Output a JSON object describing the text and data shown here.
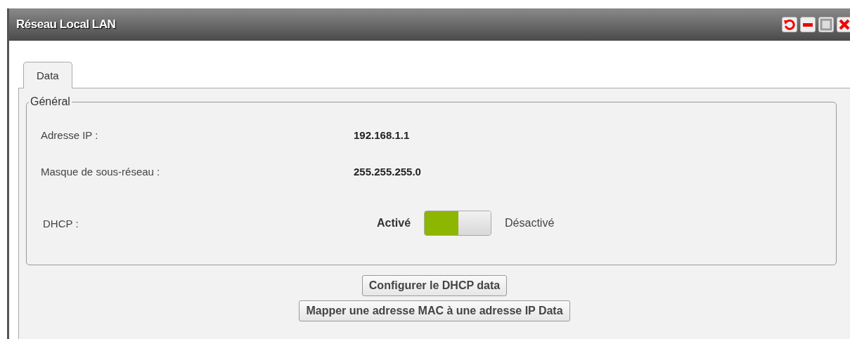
{
  "window": {
    "title": "Réseau Local LAN"
  },
  "tabs": [
    {
      "label": "Data",
      "selected": true
    }
  ],
  "fieldset": {
    "legend": "Général",
    "rows": [
      {
        "kind": "value",
        "label": "Adresse IP :",
        "value": "192.168.1.1"
      },
      {
        "kind": "value",
        "label": "Masque de sous-réseau :",
        "value": "255.255.255.0"
      },
      {
        "kind": "switch",
        "label": "DHCP :",
        "on_label": "Activé",
        "off_label": "Désactivé",
        "on": true
      }
    ]
  },
  "buttons": [
    "Configurer le DHCP data",
    "Mapper une adresse MAC à une adresse IP Data"
  ]
}
